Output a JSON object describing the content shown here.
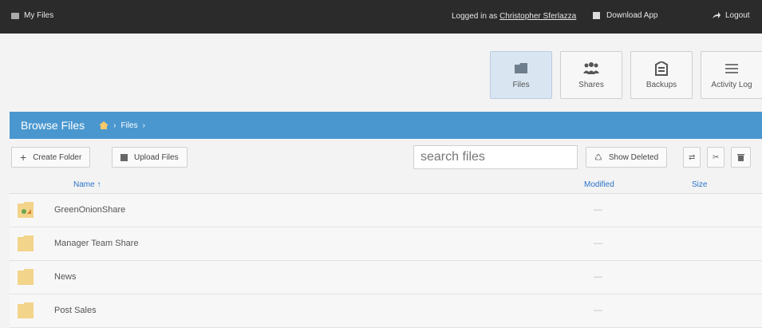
{
  "topbar": {
    "app_title": "My Files",
    "logged_prefix": "Logged in as",
    "user": "Christopher Sferlazza",
    "download_label": "Download App",
    "logout_label": "Logout"
  },
  "nav": [
    {
      "label": "Files",
      "icon": "folder-icon",
      "active": true
    },
    {
      "label": "Shares",
      "icon": "users-icon",
      "active": false
    },
    {
      "label": "Backups",
      "icon": "backup-icon",
      "active": false
    },
    {
      "label": "Activity Log",
      "icon": "list-icon",
      "active": false
    }
  ],
  "browse": {
    "title": "Browse Files",
    "crumb": "Files"
  },
  "toolbar": {
    "create_folder": "Create Folder",
    "upload_files": "Upload Files",
    "search_placeholder": "search files",
    "show_deleted": "Show Deleted"
  },
  "table": {
    "columns": {
      "name": "Name",
      "modified": "Modified",
      "size": "Size"
    },
    "rows": [
      {
        "name": "GreenOnionShare",
        "modified": "—",
        "shared": true
      },
      {
        "name": "Manager Team Share",
        "modified": "—",
        "shared": false
      },
      {
        "name": "News",
        "modified": "—",
        "shared": false
      },
      {
        "name": "Post Sales",
        "modified": "—",
        "shared": false
      }
    ]
  },
  "colors": {
    "topbar": "#2b2b2b",
    "accent": "#4a97cf",
    "link": "#2a73c8",
    "folder": "#f2d48a"
  }
}
